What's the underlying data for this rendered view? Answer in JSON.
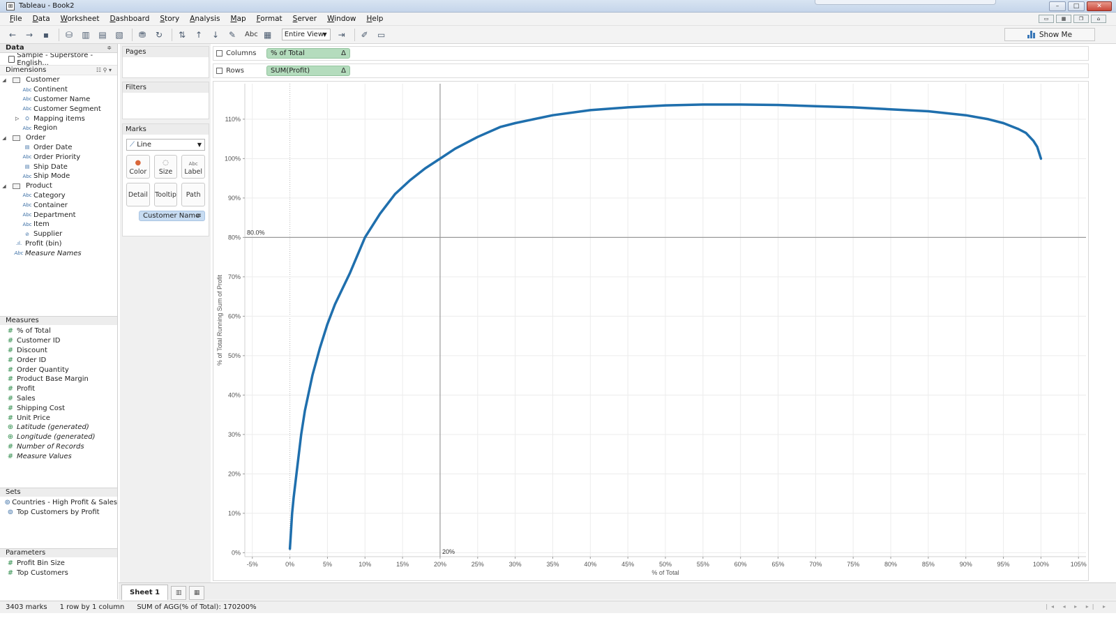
{
  "window": {
    "title": "Tableau - Book2"
  },
  "menu": [
    "File",
    "Data",
    "Worksheet",
    "Dashboard",
    "Story",
    "Analysis",
    "Map",
    "Format",
    "Server",
    "Window",
    "Help"
  ],
  "toolbar": {
    "abc_label": "Abc",
    "fit_label": "Entire View",
    "show_me_label": "Show Me"
  },
  "data_pane": {
    "header": "Data",
    "datasource": "Sample - Superstore - English...",
    "dimensions_label": "Dimensions",
    "dimensions": [
      {
        "label": "Customer",
        "type": "folder",
        "indent": 0
      },
      {
        "label": "Continent",
        "type": "abc",
        "indent": 1
      },
      {
        "label": "Customer Name",
        "type": "abc",
        "indent": 1
      },
      {
        "label": "Customer Segment",
        "type": "abc",
        "indent": 1
      },
      {
        "label": "Mapping items",
        "type": "hier",
        "indent": 1
      },
      {
        "label": "Region",
        "type": "abc",
        "indent": 1
      },
      {
        "label": "Order",
        "type": "folder",
        "indent": 0
      },
      {
        "label": "Order Date",
        "type": "date",
        "indent": 1
      },
      {
        "label": "Order Priority",
        "type": "abc",
        "indent": 1
      },
      {
        "label": "Ship Date",
        "type": "date",
        "indent": 1
      },
      {
        "label": "Ship Mode",
        "type": "abc",
        "indent": 1
      },
      {
        "label": "Product",
        "type": "folder",
        "indent": 0
      },
      {
        "label": "Category",
        "type": "abc",
        "indent": 1
      },
      {
        "label": "Container",
        "type": "abc",
        "indent": 1
      },
      {
        "label": "Department",
        "type": "abc",
        "indent": 1
      },
      {
        "label": "Item",
        "type": "abc",
        "indent": 1
      },
      {
        "label": "Supplier",
        "type": "link",
        "indent": 1
      },
      {
        "label": "Profit (bin)",
        "type": "bin",
        "indent": 0
      },
      {
        "label": "Measure Names",
        "type": "abc",
        "indent": 0,
        "italic": true
      }
    ],
    "measures_label": "Measures",
    "measures": [
      {
        "label": "% of Total",
        "italic": false
      },
      {
        "label": "Customer ID",
        "italic": false
      },
      {
        "label": "Discount",
        "italic": false
      },
      {
        "label": "Order ID",
        "italic": false
      },
      {
        "label": "Order Quantity",
        "italic": false
      },
      {
        "label": "Product Base Margin",
        "italic": false
      },
      {
        "label": "Profit",
        "italic": false
      },
      {
        "label": "Sales",
        "italic": false
      },
      {
        "label": "Shipping Cost",
        "italic": false
      },
      {
        "label": "Unit Price",
        "italic": false
      },
      {
        "label": "Latitude (generated)",
        "italic": true,
        "icon": "globe"
      },
      {
        "label": "Longitude (generated)",
        "italic": true,
        "icon": "globe"
      },
      {
        "label": "Number of Records",
        "italic": true
      },
      {
        "label": "Measure Values",
        "italic": true
      }
    ],
    "sets_label": "Sets",
    "sets": [
      "Countries - High Profit & Sales",
      "Top Customers by Profit"
    ],
    "parameters_label": "Parameters",
    "parameters": [
      "Profit Bin Size",
      "Top Customers"
    ]
  },
  "shelves": {
    "pages": "Pages",
    "filters": "Filters",
    "marks": "Marks",
    "mark_type": "Line",
    "mark_buttons": [
      "Color",
      "Size",
      "Label",
      "Detail",
      "Tooltip",
      "Path"
    ],
    "path_pill": "Customer Name",
    "columns_label": "Columns",
    "columns_pill": "% of Total",
    "rows_label": "Rows",
    "rows_pill": "SUM(Profit)",
    "delta": "Δ"
  },
  "chart_data": {
    "type": "line",
    "xlabel": "% of Total",
    "ylabel": "% of Total Running Sum of Profit",
    "xlim": [
      -6,
      106
    ],
    "ylim": [
      -1,
      119
    ],
    "x_ticks": [
      "-5%",
      "0%",
      "5%",
      "10%",
      "15%",
      "20%",
      "25%",
      "30%",
      "35%",
      "40%",
      "45%",
      "50%",
      "55%",
      "60%",
      "65%",
      "70%",
      "75%",
      "80%",
      "85%",
      "90%",
      "95%",
      "100%",
      "105%"
    ],
    "y_ticks": [
      "0%",
      "10%",
      "20%",
      "30%",
      "40%",
      "50%",
      "60%",
      "70%",
      "80%",
      "90%",
      "100%",
      "110%"
    ],
    "x_tick_values": [
      -5,
      0,
      5,
      10,
      15,
      20,
      25,
      30,
      35,
      40,
      45,
      50,
      55,
      60,
      65,
      70,
      75,
      80,
      85,
      90,
      95,
      100,
      105
    ],
    "y_tick_values": [
      0,
      10,
      20,
      30,
      40,
      50,
      60,
      70,
      80,
      90,
      100,
      110
    ],
    "grid": true,
    "series": [
      {
        "color": "#1f6fad",
        "x": [
          0,
          0.1,
          0.3,
          0.5,
          1,
          1.5,
          2,
          3,
          4,
          5,
          6,
          7,
          8,
          10,
          12,
          14,
          16,
          18,
          20,
          22,
          25,
          28,
          30,
          35,
          40,
          45,
          50,
          55,
          60,
          65,
          70,
          75,
          80,
          85,
          90,
          93,
          95,
          97,
          98,
          99,
          99.5,
          100
        ],
        "y": [
          1,
          4,
          10,
          14,
          22,
          30,
          36,
          45,
          52,
          58,
          63,
          67,
          71,
          80,
          86,
          91,
          94.5,
          97.5,
          100,
          102.5,
          105.5,
          108,
          109,
          111,
          112.3,
          113,
          113.5,
          113.7,
          113.7,
          113.6,
          113.3,
          113,
          112.5,
          112,
          111,
          110,
          109,
          107.5,
          106.5,
          104.5,
          103,
          100
        ]
      }
    ],
    "reference_lines": [
      {
        "axis": "y",
        "value": 80,
        "label": "80.0%"
      },
      {
        "axis": "x",
        "value": 20,
        "label": "20%"
      }
    ]
  },
  "tabs": {
    "sheet": "Sheet 1"
  },
  "status": {
    "marks": "3403 marks",
    "rows_cols": "1 row by 1 column",
    "agg": "SUM of AGG(% of Total): 170200%"
  }
}
